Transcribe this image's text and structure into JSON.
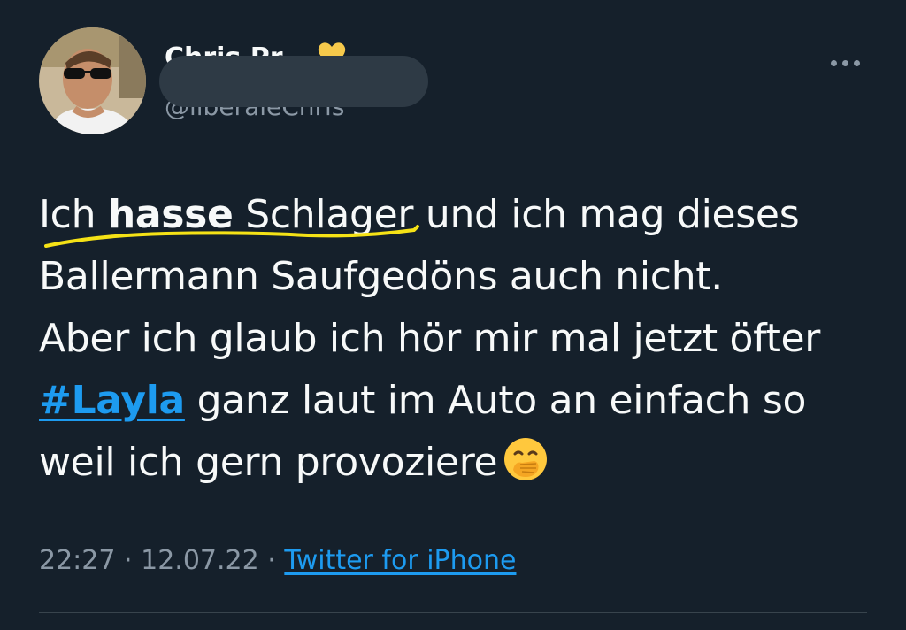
{
  "author": {
    "display_name": "Chris Pr",
    "handle": "@liberaleChris",
    "badge_icon": "yellow-heart-icon",
    "avatar_icon": "profile-photo"
  },
  "menu": {
    "icon": "more-options-icon"
  },
  "tweet": {
    "line1_w1": "Ich",
    "line1_bold": "hasse",
    "line1_rest": "Schlager und ich mag dieses",
    "line2": "Ballermann Saufgedöns auch nicht.",
    "line3": "Aber ich glaub ich hör mir mal jetzt öfter",
    "hashtag": "#Layla",
    "line4_rest": "ganz laut im Auto an einfach so",
    "line5": "weil ich gern provoziere",
    "emoji_icon": "face-with-hand-over-mouth-icon",
    "highlight_color": "#f5e216"
  },
  "meta": {
    "time": "22:27",
    "sep1": "·",
    "date": "12.07.22",
    "sep2": "·",
    "source": "Twitter for iPhone"
  },
  "colors": {
    "background": "#15202b",
    "text": "#f7f9f9",
    "secondary": "#8b98a5",
    "link": "#1d9bf0"
  }
}
